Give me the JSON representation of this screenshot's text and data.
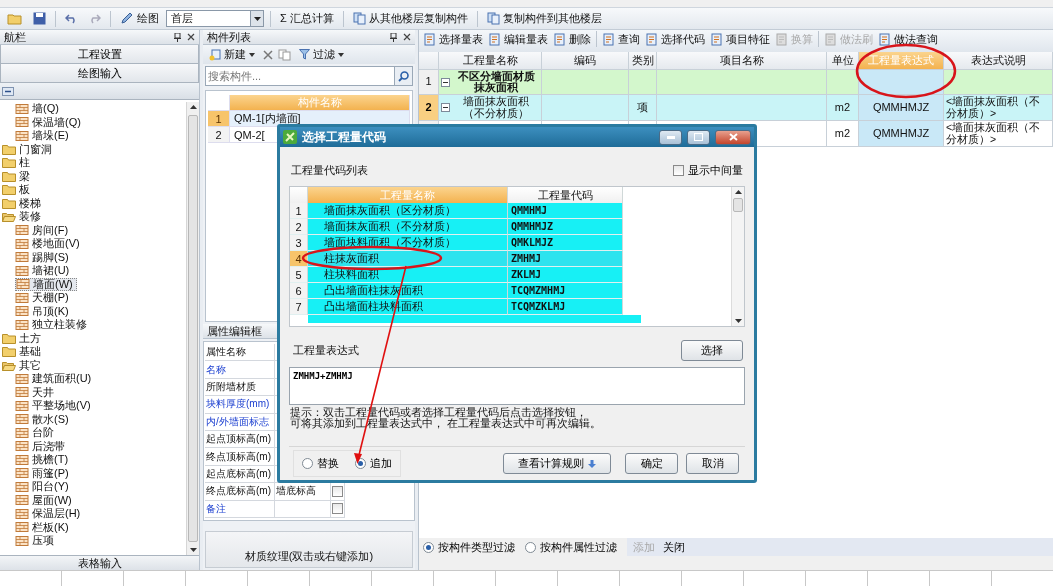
{
  "toolbar": {
    "draw_label": "绘图",
    "floor": "首层",
    "buttons": [
      {
        "icon": "Σ",
        "label": "汇总计算"
      },
      {
        "label": "从其他楼层复制构件"
      },
      {
        "label": "复制构件到其他楼层"
      }
    ]
  },
  "nav_panel": {
    "title": "航栏",
    "buttons": [
      "工程设置",
      "绘图输入"
    ],
    "tree": [
      {
        "children": [
          {
            "label": "墙(Q)",
            "selected": false
          },
          {
            "label": "保温墙(Q)",
            "selected": false
          },
          {
            "label": "墙垛(E)",
            "selected": false
          }
        ]
      },
      {
        "label": "门窗洞",
        "expanded": false
      },
      {
        "label": "柱",
        "expanded": false
      },
      {
        "label": "梁",
        "expanded": false
      },
      {
        "label": "板",
        "expanded": false
      },
      {
        "label": "楼梯",
        "expanded": false
      },
      {
        "label": "装修",
        "expanded": true,
        "children": [
          {
            "label": "房间(F)",
            "selected": false
          },
          {
            "label": "楼地面(V)",
            "selected": false
          },
          {
            "label": "踢脚(S)",
            "selected": false
          },
          {
            "label": "墙裙(U)",
            "selected": false
          },
          {
            "label": "墙面(W)",
            "selected": true
          },
          {
            "label": "天棚(P)",
            "selected": false
          },
          {
            "label": "吊顶(K)",
            "selected": false
          },
          {
            "label": "独立柱装修",
            "selected": false
          }
        ]
      },
      {
        "label": "土方",
        "expanded": false
      },
      {
        "label": "基础",
        "expanded": false
      },
      {
        "label": "其它",
        "expanded": true,
        "children": [
          {
            "label": "建筑面积(U)",
            "selected": false
          },
          {
            "label": "天井",
            "selected": false
          },
          {
            "label": "平整场地(V)",
            "selected": false
          },
          {
            "label": "散水(S)",
            "selected": false
          },
          {
            "label": "台阶",
            "selected": false
          },
          {
            "label": "后浇带",
            "selected": false
          },
          {
            "label": "挑檐(T)",
            "selected": false
          },
          {
            "label": "雨篷(P)",
            "selected": false
          },
          {
            "label": "阳台(Y)",
            "selected": false
          },
          {
            "label": "屋面(W)",
            "selected": false
          },
          {
            "label": "保温层(H)",
            "selected": false
          },
          {
            "label": "栏板(K)",
            "selected": false
          },
          {
            "label": "压项",
            "selected": false
          }
        ]
      }
    ],
    "footer": "表格输入"
  },
  "component_list": {
    "title": "构件列表",
    "new_label": "新建",
    "filter_label": "过滤",
    "search": {
      "placeholder": "搜索构件..."
    },
    "column": "构件名称",
    "rows": [
      {
        "num": "1",
        "name": "QM-1[内墙面]",
        "selected": true
      },
      {
        "num": "2",
        "name": "QM-2[",
        "selected": false
      }
    ]
  },
  "property_editor": {
    "title": "属性编辑框",
    "header": "属性名称",
    "rows": [
      {
        "name": "名称",
        "public": true
      },
      {
        "name": "所附墙材质",
        "public": false
      },
      {
        "name": "块料厚度(mm)",
        "public": true
      },
      {
        "name": "内/外墙面标志",
        "public": true
      },
      {
        "name": "起点顶标高(m)",
        "public": false
      },
      {
        "name": "终点顶标高(m)",
        "public": false
      },
      {
        "name": "起点底标高(m)",
        "public": false
      },
      {
        "name": "终点底标高(m)",
        "public": false,
        "value": "墙底标高",
        "checked": false
      },
      {
        "name": "备注",
        "public": true,
        "checked": false
      }
    ],
    "texture_hint": "材质纹理(双击或右键添加)"
  },
  "quantity_panel": {
    "toolbar": [
      {
        "label": "选择量表",
        "disabled": false
      },
      {
        "label": "编辑量表",
        "disabled": false
      },
      {
        "label": "删除",
        "disabled": false
      },
      {
        "label": "查询",
        "disabled": false
      },
      {
        "label": "选择代码",
        "disabled": false
      },
      {
        "label": "项目特征",
        "disabled": false
      },
      {
        "label": "换算",
        "disabled": true
      },
      {
        "label": "做法刷",
        "disabled": true
      },
      {
        "label": "做法查询",
        "disabled": false
      }
    ],
    "columns": [
      {
        "label": "工程量名称",
        "selected": false
      },
      {
        "label": "编码",
        "selected": false
      },
      {
        "label": "类别",
        "selected": false
      },
      {
        "label": "项目名称",
        "selected": false
      },
      {
        "label": "单位",
        "selected": false
      },
      {
        "label": "工程量表达式",
        "selected": true
      },
      {
        "label": "表达式说明",
        "selected": false
      }
    ],
    "rows": [
      {
        "num": "1",
        "kind": "group",
        "name": "不区分墙面材质抹灰面积",
        "selected": false
      },
      {
        "num": "2",
        "kind": "item",
        "name": "墙面抹灰面积（不分材质）",
        "category": "项",
        "unit": "m2",
        "expression": "QMMHMJZ",
        "description": "<墙面抹灰面积（不分材质）>",
        "selected": true
      },
      {
        "kind": "item",
        "unit": "m2",
        "expression": "QMMHMJZ",
        "description": "<墙面抹灰面积（不分材质）>",
        "selected": false
      }
    ],
    "filters": [
      {
        "label": "按构件类型过滤",
        "selected": true
      },
      {
        "label": "按构件属性过滤",
        "selected": false
      }
    ],
    "actions": [
      {
        "label": "添加",
        "disabled": true
      },
      {
        "label": "关闭",
        "disabled": false
      }
    ]
  },
  "dialog": {
    "title": "选择工程量代码",
    "list_label": "工程量代码列表",
    "show_intermediate": {
      "label": "显示中间量",
      "checked": false
    },
    "columns": [
      {
        "label": "工程量名称",
        "selected": true
      },
      {
        "label": "工程量代码",
        "selected": false
      }
    ],
    "rows": [
      {
        "num": "1",
        "name": "墙面抹灰面积（区分材质）",
        "code": "QMMHMJ",
        "selected": false
      },
      {
        "num": "2",
        "name": "墙面抹灰面积（不分材质）",
        "code": "QMMHMJZ",
        "selected": false
      },
      {
        "num": "3",
        "name": "墙面块料面积（不分材质）",
        "code": "QMKLMJZ",
        "selected": false
      },
      {
        "num": "4",
        "name": "柱抹灰面积",
        "code": "ZMHMJ",
        "selected": true
      },
      {
        "num": "5",
        "name": "柱块料面积",
        "code": "ZKLMJ",
        "selected": false
      },
      {
        "num": "6",
        "name": "凸出墙面柱抹灰面积",
        "code": "TCQMZMHMJ",
        "selected": false
      },
      {
        "num": "7",
        "name": "凸出墙面柱块料面积",
        "code": "TCQMZKLMJ",
        "selected": false
      }
    ],
    "expression_label": "工程量表达式",
    "select_button": "选择",
    "expression": "ZMHMJ+ZMHMJ",
    "hint": [
      "提示：双击工程量代码或者选择工程量代码后点击选择按钮，",
      "可将其添加到工程量表达式中， 在工程量表达式中可再次编辑。"
    ],
    "modes": [
      {
        "label": "替换",
        "selected": false
      },
      {
        "label": "追加",
        "selected": true
      }
    ],
    "buttons": [
      {
        "label": "查看计算规则",
        "kind": "dropdown"
      },
      {
        "label": "确定",
        "kind": "plain"
      },
      {
        "label": "取消",
        "kind": "plain"
      }
    ]
  }
}
